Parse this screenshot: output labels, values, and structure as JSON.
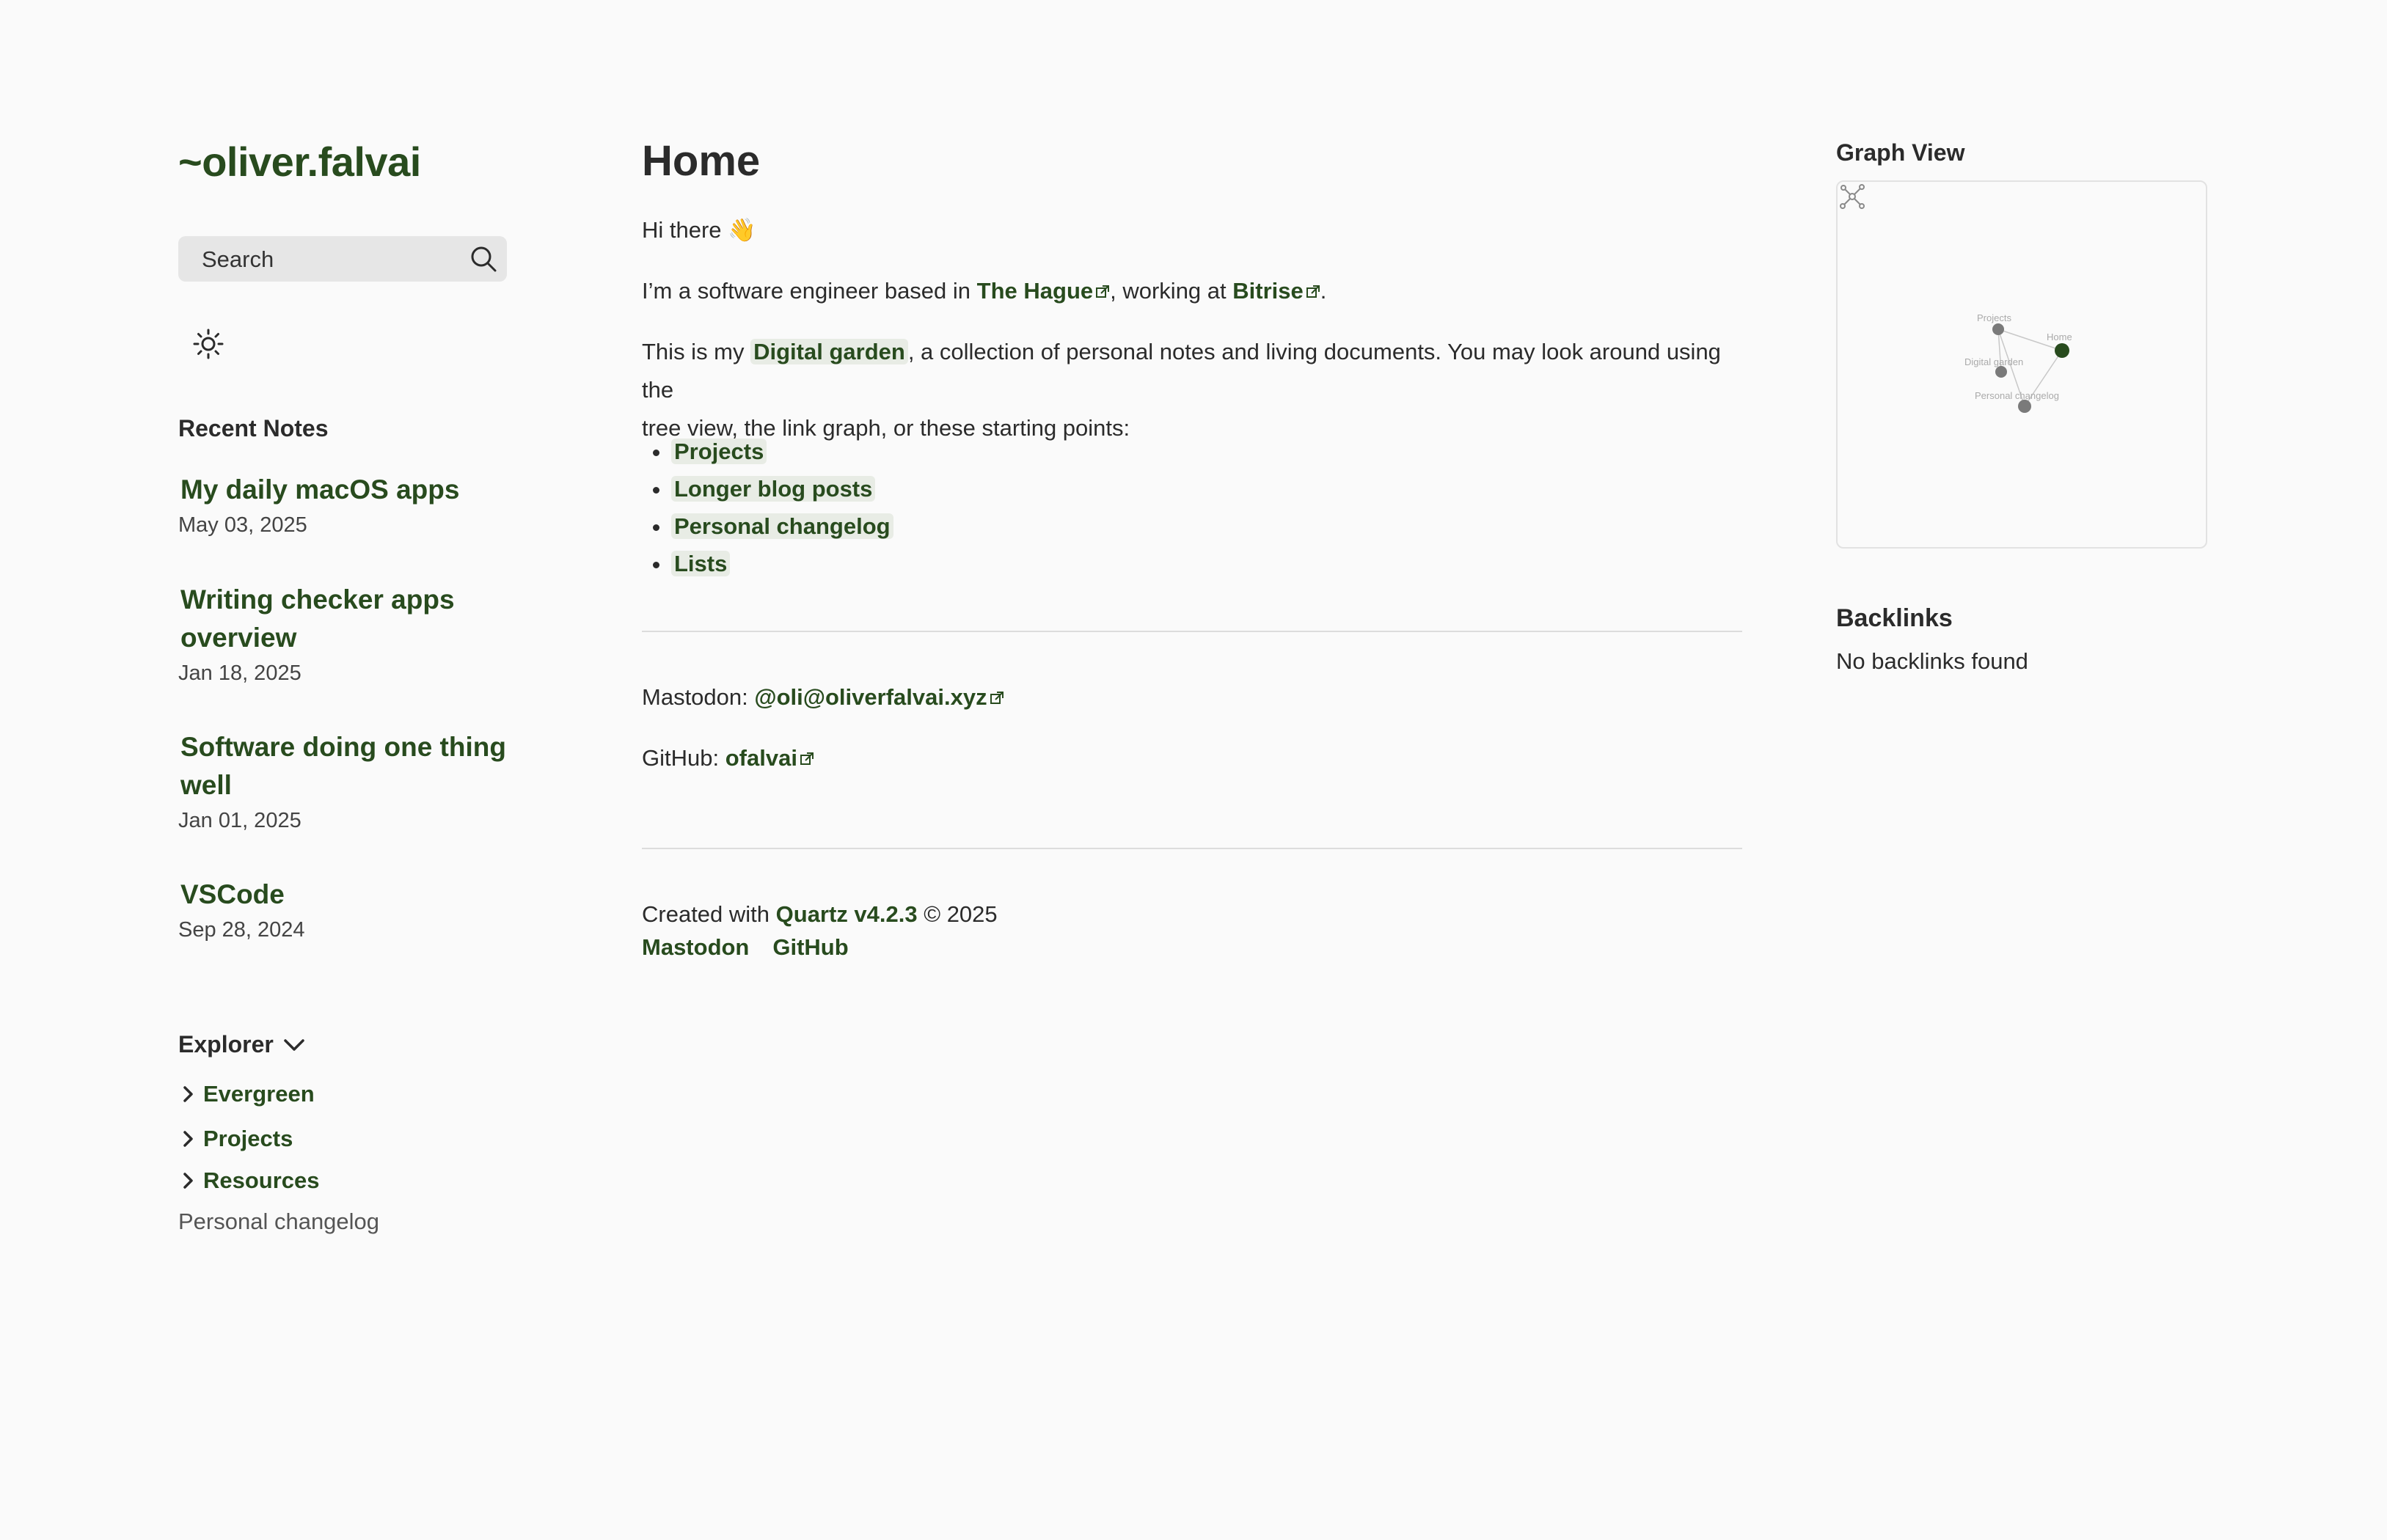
{
  "site": {
    "title": "~oliver.falvai",
    "search_label": "Search"
  },
  "recent": {
    "heading": "Recent Notes",
    "notes": [
      {
        "title": "My daily macOS apps",
        "date": "May 03, 2025"
      },
      {
        "title": "Writing checker apps overview",
        "date": "Jan 18, 2025"
      },
      {
        "title": "Software doing one thing well",
        "date": "Jan 01, 2025"
      },
      {
        "title": "VSCode",
        "date": "Sep 28, 2024"
      }
    ]
  },
  "explorer": {
    "heading": "Explorer",
    "folders": [
      "Evergreen",
      "Projects",
      "Resources"
    ],
    "files": [
      "Personal changelog"
    ]
  },
  "main": {
    "title": "Home",
    "greeting": "Hi there 👋",
    "intro_prefix": "I’m a software engineer based in ",
    "city_link": "The Hague",
    "intro_mid": ", working at ",
    "company_link": "Bitrise",
    "intro_suffix": ".",
    "garden_prefix": "This is my ",
    "garden_link": "Digital garden",
    "garden_line1_suffix": ", a collection of personal notes and living documents. You may look around using the",
    "garden_line2": "tree view, the link graph, or these starting points:",
    "starting_points": [
      "Projects",
      "Longer blog posts",
      "Personal changelog",
      "Lists"
    ],
    "mastodon_label": "Mastodon: ",
    "mastodon_link": "@oli@oliverfalvai.xyz",
    "github_label": "GitHub: ",
    "github_link": "ofalvai"
  },
  "footer": {
    "created_prefix": "Created with ",
    "quartz_link": "Quartz v4.2.3",
    "created_suffix": " © 2025",
    "links": [
      "Mastodon",
      "GitHub"
    ]
  },
  "sidebar_right": {
    "graph_heading": "Graph View",
    "graph_nodes": [
      "Projects",
      "Home",
      "Digital garden",
      "Personal changelog"
    ],
    "backlinks_heading": "Backlinks",
    "backlinks_empty": "No backlinks found"
  },
  "colors": {
    "accent": "#284b1e",
    "background": "#fafafa",
    "text": "#2b2b2b",
    "highlight": "#e8ece5"
  }
}
